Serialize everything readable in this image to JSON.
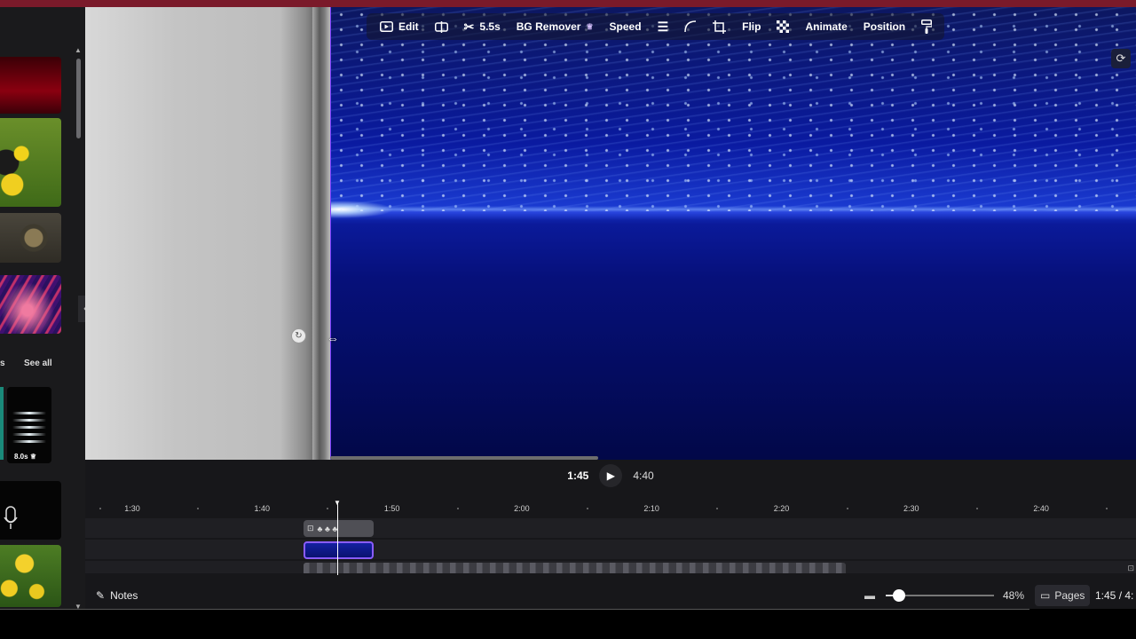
{
  "window": {
    "accent_bar_color": "#7a1a2a"
  },
  "toolbar": {
    "edit": "Edit",
    "trim_icon": "trim-icon",
    "split_duration": "5.5s",
    "bg_remover": "BG Remover",
    "speed": "Speed",
    "flip": "Flip",
    "animate": "Animate",
    "position": "Position"
  },
  "sidebar": {
    "section_label": "s",
    "see_all": "See all",
    "video_duration": "8.0s"
  },
  "playback": {
    "current_time": "1:45",
    "total_time": "4:40"
  },
  "timeline": {
    "ticks": [
      "1:30",
      "1:40",
      "1:50",
      "2:00",
      "2:10",
      "2:20",
      "2:30",
      "2:40"
    ],
    "clip1_label": "⊡"
  },
  "bottombar": {
    "notes": "Notes",
    "zoom_level": "48%",
    "zoom_fraction": 0.12,
    "pages": "Pages",
    "page_time": "1:45 / 4:"
  }
}
